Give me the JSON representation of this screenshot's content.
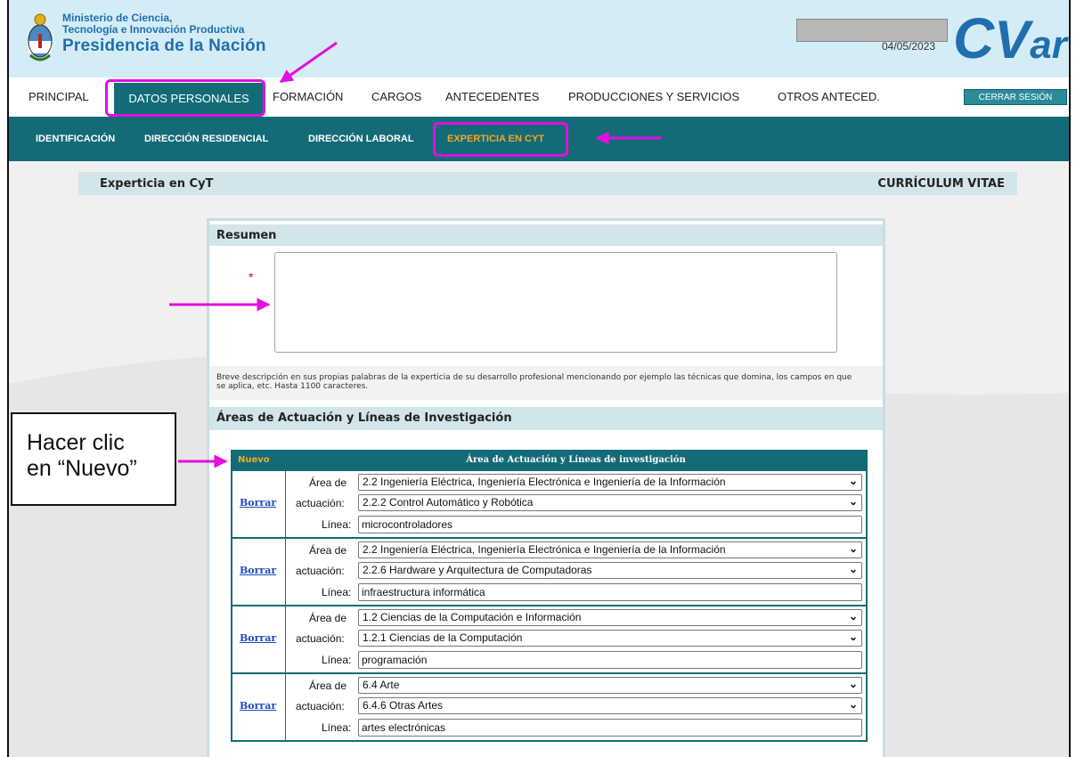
{
  "header": {
    "ministry_line1": "Ministerio de Ciencia,",
    "ministry_line2": "Tecnología e Innovación Productiva",
    "ministry_line3": "Presidencia de la Nación",
    "date": "04/05/2023",
    "logo": {
      "c": "C",
      "v": "V",
      "ar": "ar"
    }
  },
  "main_nav": {
    "items": [
      "PRINCIPAL",
      "DATOS PERSONALES",
      "FORMACIÓN",
      "CARGOS",
      "ANTECEDENTES",
      "PRODUCCIONES Y SERVICIOS",
      "OTROS ANTECED."
    ],
    "active": "DATOS PERSONALES",
    "logout": "CERRAR SESIÓN"
  },
  "sub_nav": {
    "items": [
      "IDENTIFICACIÓN",
      "DIRECCIÓN RESIDENCIAL",
      "DIRECCIÓN LABORAL",
      "EXPERTICIA EN CYT"
    ],
    "active": "EXPERTICIA EN CYT"
  },
  "section": {
    "title": "Experticia en CyT",
    "cv_label": "CURRÍCULUM VITAE"
  },
  "summary": {
    "heading": "Resumen",
    "required_mark": "*",
    "value": "",
    "hint": "Breve descripción en sus propias palabras de la experticia de su desarrollo profesional mencionando por ejemplo las técnicas que domina, los campos en que se aplica, etc. Hasta 1100 caracteres."
  },
  "areas": {
    "heading": "Áreas de Actuación y Líneas de Investigación",
    "new_label": "Nuevo",
    "column_title": "Área de Actuación y Líneas de investigación",
    "area_label_1": "Área de",
    "area_label_2": "actuación:",
    "line_label": "Línea:",
    "delete_label": "Borrar",
    "records": [
      {
        "area": "2.2 Ingeniería Eléctrica, Ingeniería Electrónica e Ingeniería de la Información",
        "subarea": "2.2.2 Control Automático y Robótica",
        "line": "microcontroladores"
      },
      {
        "area": "2.2 Ingeniería Eléctrica, Ingeniería Electrónica e Ingeniería de la Información",
        "subarea": "2.2.6 Hardware y Arquitectura de Computadoras",
        "line": "infraestructura informática"
      },
      {
        "area": "1.2 Ciencias de la Computación e Información",
        "subarea": "1.2.1 Ciencias de la Computación",
        "line": "programación"
      },
      {
        "area": "6.4 Arte",
        "subarea": "6.4.6 Otras Artes",
        "line": "artes electrónicas"
      }
    ]
  },
  "annotation": {
    "callout_line1": "Hacer clic",
    "callout_line2": "en “Nuevo”",
    "highlight_color": "#e010e0"
  },
  "colors": {
    "teal": "#136b78",
    "header_bg": "#d4ecf6",
    "accent_orange": "#f5a623",
    "brand_blue": "#1f6fae"
  }
}
